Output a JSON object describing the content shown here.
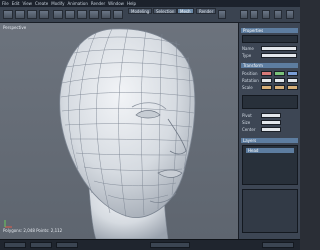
{
  "menu": [
    "File",
    "Edit",
    "View",
    "Create",
    "Modify",
    "Animation",
    "Render",
    "Window",
    "Help"
  ],
  "toolbar": {
    "tabs": [
      "Modeling",
      "Selection",
      "Mesh",
      "Render"
    ],
    "active_tab": "Mesh",
    "buttons": [
      "select",
      "move",
      "rotate",
      "scale",
      "extrude",
      "cut",
      "weld",
      "smooth",
      "knife",
      "bevel",
      "mirror",
      "undo",
      "redo"
    ]
  },
  "viewport": {
    "label": "Perspective",
    "footer": "Polygons: 2,048   Points: 2,112",
    "subject": "head wireframe mesh",
    "colors": {
      "background": "#666d77",
      "mesh": "#d9dde3",
      "wire": "#7c8592"
    }
  },
  "panel": {
    "headers": [
      "Properties",
      "Transform",
      "Layers"
    ],
    "rows": [
      "Name",
      "Type",
      "Position",
      "Rotation",
      "Scale",
      "Pivot",
      "Size",
      "Center"
    ],
    "layer_item": "Head"
  },
  "statusbar": {
    "items": 5
  }
}
